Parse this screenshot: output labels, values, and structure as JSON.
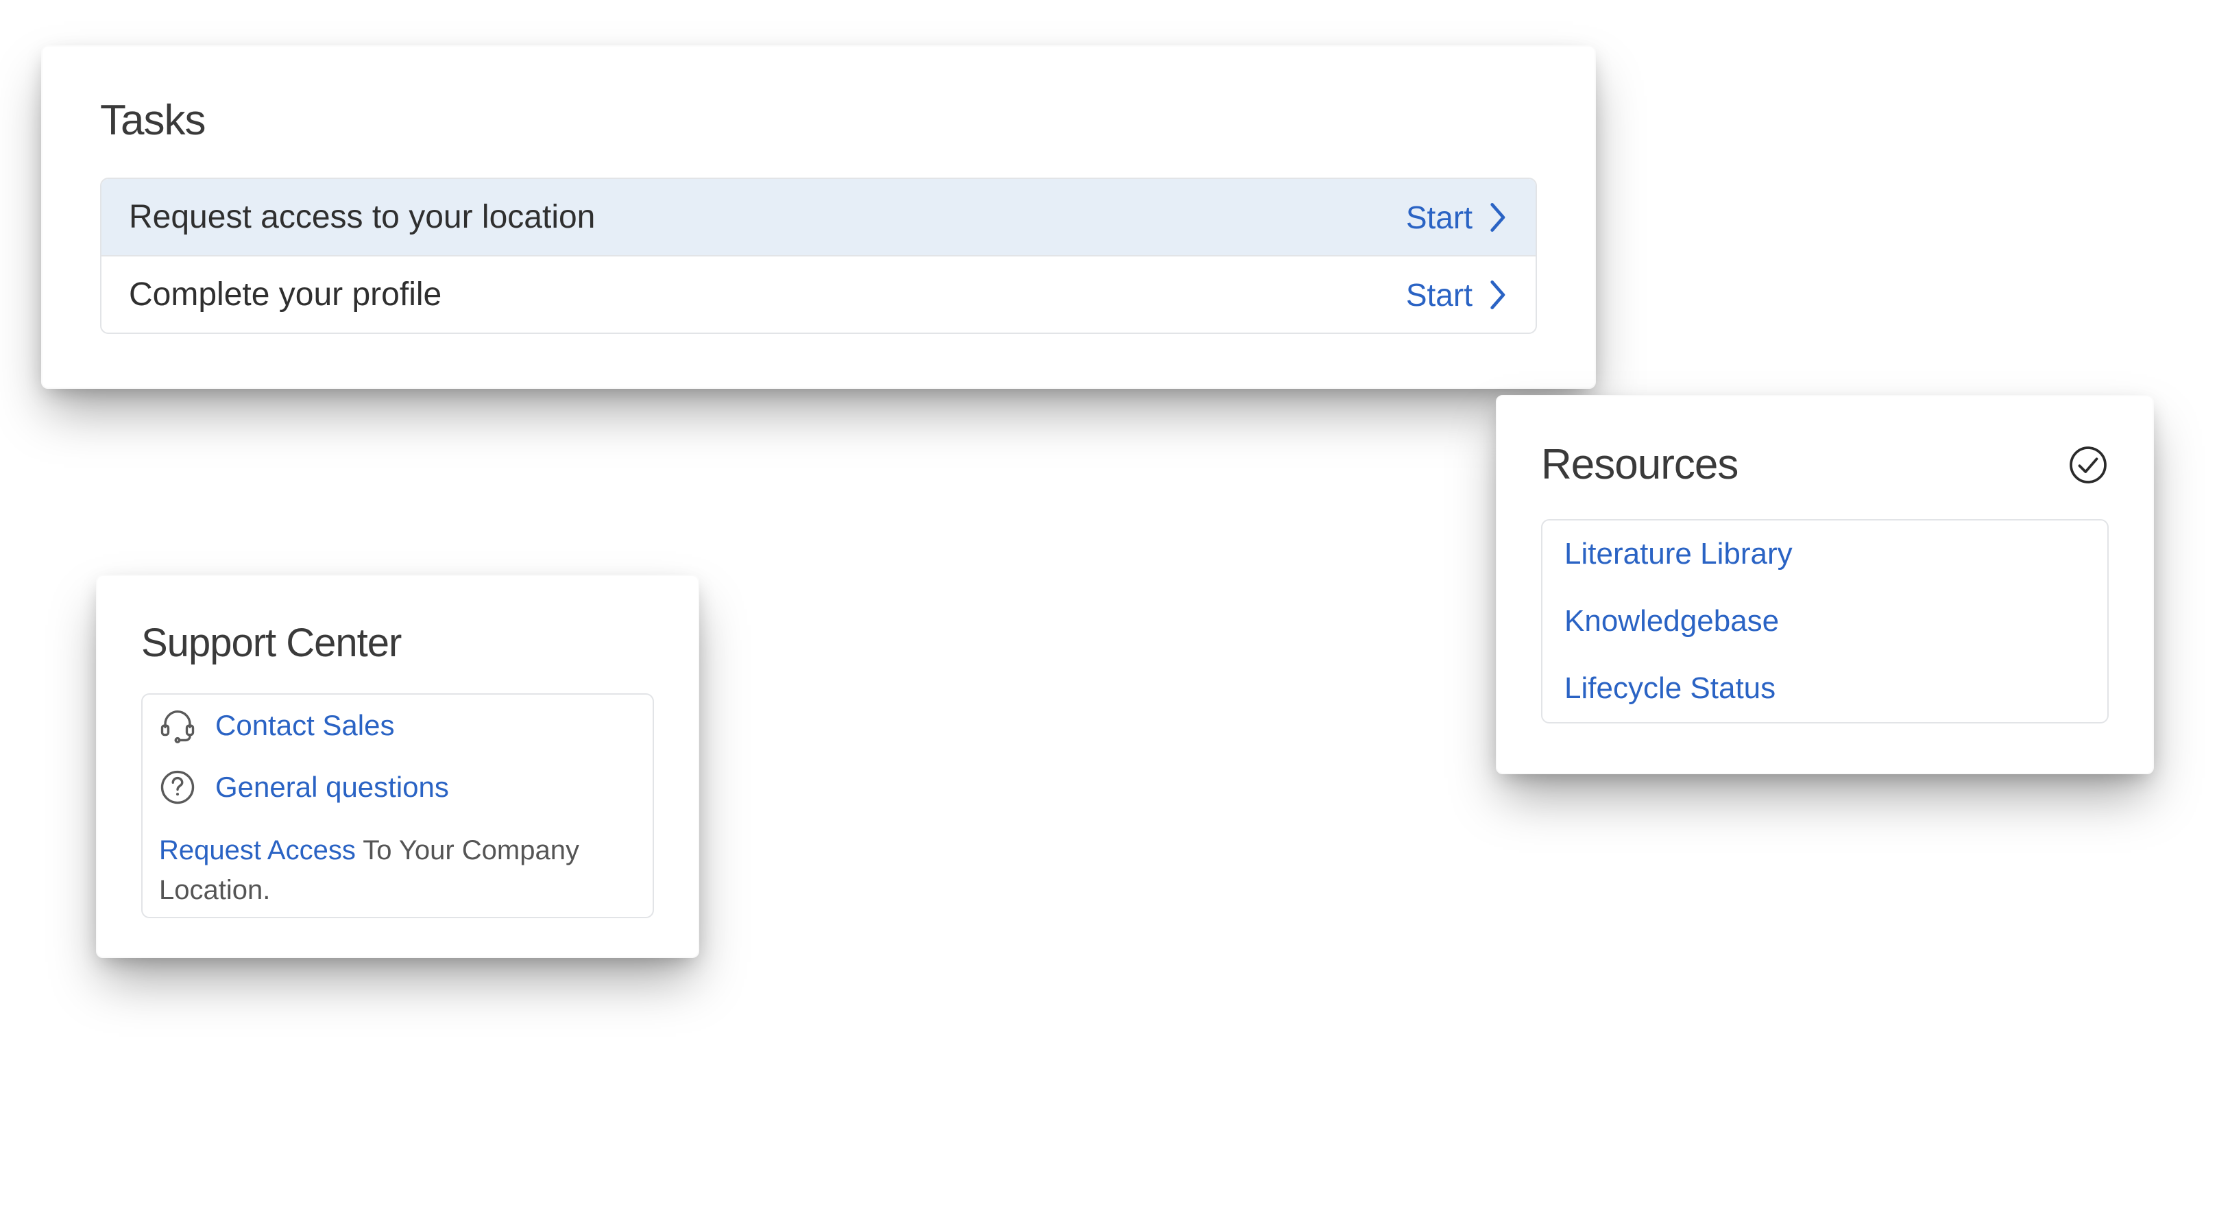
{
  "tasks": {
    "title": "Tasks",
    "action_label": "Start",
    "items": [
      {
        "label": "Request access to your location",
        "highlight": true
      },
      {
        "label": "Complete your profile",
        "highlight": false
      }
    ]
  },
  "support": {
    "title": "Support Center",
    "items": [
      {
        "icon": "headset",
        "label": "Contact Sales"
      },
      {
        "icon": "question",
        "label": "General questions"
      }
    ],
    "note_link": "Request Access",
    "note_rest": " To Your Company Location."
  },
  "resources": {
    "title": "Resources",
    "items": [
      {
        "label": "Literature Library"
      },
      {
        "label": "Knowledgebase"
      },
      {
        "label": "Lifecycle Status"
      }
    ]
  }
}
